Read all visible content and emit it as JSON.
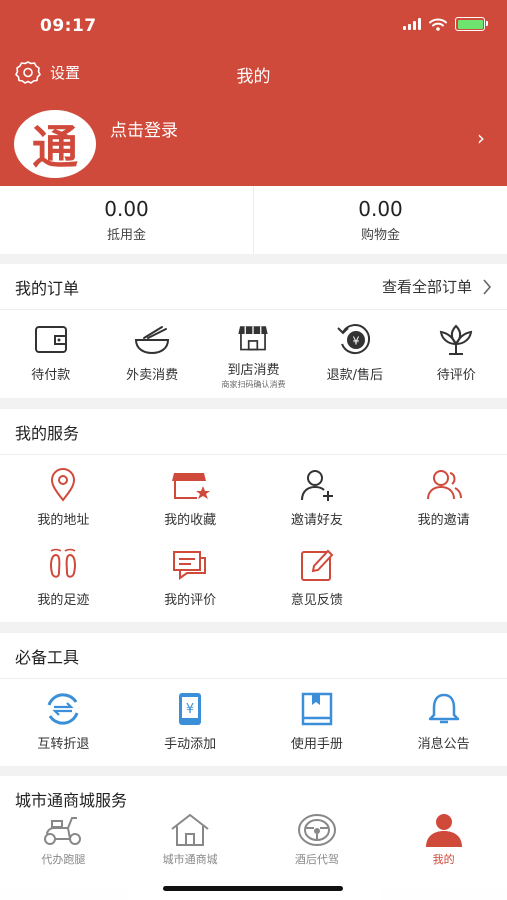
{
  "status": {
    "time": "09:17"
  },
  "header": {
    "settings_label": "设置",
    "title": "我的",
    "login_text": "点击登录",
    "logo_char": "通",
    "arrow": "›"
  },
  "balance": [
    {
      "value": "0.00",
      "label": "抵用金"
    },
    {
      "value": "0.00",
      "label": "购物金"
    }
  ],
  "orders": {
    "title": "我的订单",
    "view_all": "查看全部订单",
    "items": [
      {
        "label": "待付款",
        "icon": "wallet-icon"
      },
      {
        "label": "外卖消费",
        "icon": "bowl-icon"
      },
      {
        "label": "到店消费",
        "sub": "商家扫码确认消费",
        "icon": "store-icon"
      },
      {
        "label": "退款/售后",
        "icon": "refund-icon"
      },
      {
        "label": "待评价",
        "icon": "lotus-icon"
      }
    ]
  },
  "services": {
    "title": "我的服务",
    "items": [
      {
        "label": "我的地址",
        "icon": "location-icon"
      },
      {
        "label": "我的收藏",
        "icon": "favorite-shop-icon"
      },
      {
        "label": "邀请好友",
        "icon": "add-user-icon"
      },
      {
        "label": "我的邀请",
        "icon": "users-icon"
      },
      {
        "label": "我的足迹",
        "icon": "footprint-icon"
      },
      {
        "label": "我的评价",
        "icon": "comment-icon"
      },
      {
        "label": "意见反馈",
        "icon": "edit-icon"
      }
    ]
  },
  "tools": {
    "title": "必备工具",
    "items": [
      {
        "label": "互转折退",
        "icon": "exchange-icon"
      },
      {
        "label": "手动添加",
        "icon": "phone-yuan-icon"
      },
      {
        "label": "使用手册",
        "icon": "manual-icon"
      },
      {
        "label": "消息公告",
        "icon": "bell-icon"
      }
    ]
  },
  "mall": {
    "title": "城市通商城服务"
  },
  "tabbar": [
    {
      "label": "代办跑腿",
      "icon": "scooter-icon"
    },
    {
      "label": "城市通商城",
      "icon": "home-icon"
    },
    {
      "label": "酒后代驾",
      "icon": "steering-wheel-icon"
    },
    {
      "label": "我的",
      "icon": "profile-icon",
      "active": true
    }
  ],
  "colors": {
    "brand": "#d04a3b",
    "tool_blue": "#3a8fd8"
  }
}
